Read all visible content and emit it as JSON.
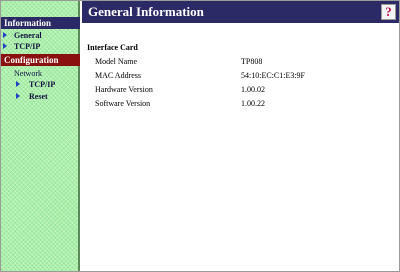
{
  "sidebar": {
    "information": {
      "header": "Information",
      "items": [
        {
          "label": "General"
        },
        {
          "label": "TCP/IP"
        }
      ]
    },
    "configuration": {
      "header": "Configuration",
      "group_label": "Network",
      "items": [
        {
          "label": "TCP/IP"
        },
        {
          "label": "Reset"
        }
      ]
    }
  },
  "main": {
    "title": "General Information",
    "help_label": "?",
    "section_title": "Interface Card",
    "rows": [
      {
        "key": "Model Name",
        "value": "TP808"
      },
      {
        "key": "MAC Address",
        "value": "54:10:EC:C1:E3:9F"
      },
      {
        "key": "Hardware Version",
        "value": "1.00.02"
      },
      {
        "key": "Software Version",
        "value": "1.00.22"
      }
    ]
  },
  "colors": {
    "header_navy": "#2c2a66",
    "header_red": "#8a1010",
    "sidebar_green": "#a9f0a9",
    "arrow_blue": "#2040c0",
    "help_mark": "#c01050"
  }
}
